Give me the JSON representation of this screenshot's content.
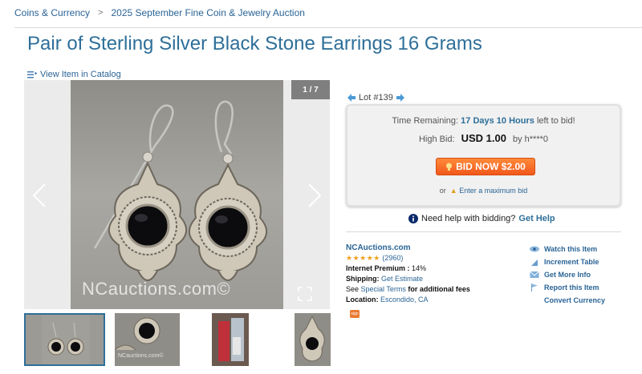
{
  "breadcrumb": {
    "items": [
      "Coins & Currency",
      "2025 September Fine Coin & Jewelry Auction"
    ],
    "separator": ">"
  },
  "title": "Pair of Sterling Silver Black Stone Earrings 16 Grams",
  "catalog_link": "View Item in Catalog",
  "viewer": {
    "counter": "1 / 7",
    "watermark": "NCauctions.com©",
    "thumb_watermark": "NCauctions.com©"
  },
  "lot": {
    "label": "Lot #139"
  },
  "bid": {
    "time_label": "Time Remaining:",
    "time_value": "17 Days 10 Hours",
    "time_suffix": "left to bid!",
    "high_label": "High Bid:",
    "high_value": "USD 1.00",
    "high_by": "by h****0",
    "button": "BID NOW $2.00",
    "or": "or",
    "max_link": "Enter a maximum bid"
  },
  "help": {
    "text": "Need help with bidding?",
    "link": "Get Help"
  },
  "info": {
    "seller": "NCAuctions.com",
    "stars": "★★★★★",
    "rating": "(2960)",
    "premium_label": "Internet Premium :",
    "premium_value": "14%",
    "shipping_label": "Shipping:",
    "shipping_link": "Get Estimate",
    "terms_prefix": "See",
    "terms_link": "Special Terms",
    "terms_suffix": "for additional fees",
    "location_label": "Location:",
    "location_value": "Escondido, CA",
    "badge": "sign"
  },
  "actions": [
    "Watch this Item",
    "Increment Table",
    "Get More Info",
    "Report this Item",
    "Convert Currency"
  ],
  "colors": {
    "accent": "#2e6f99",
    "bid_button": "#f2581b",
    "stars": "#f0a020"
  }
}
